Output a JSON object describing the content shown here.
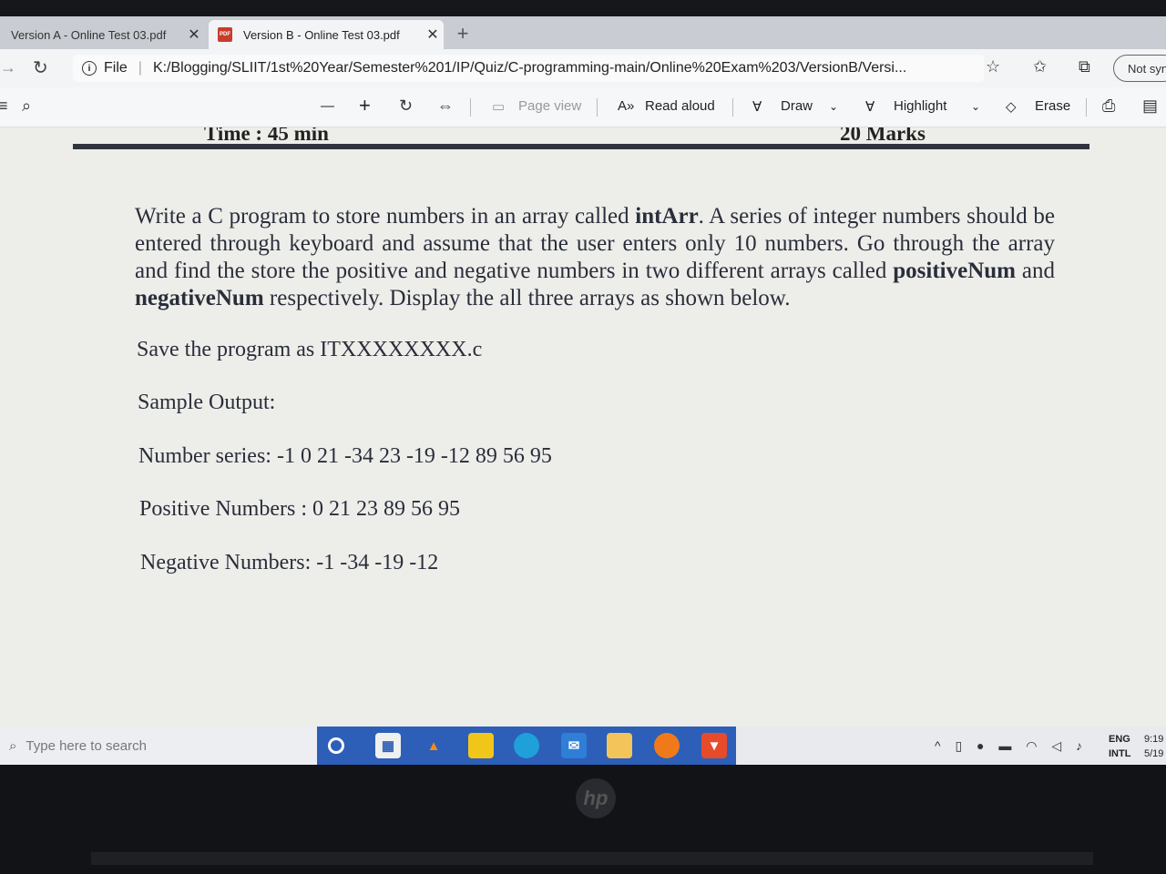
{
  "tabs": [
    {
      "label": "Version A - Online Test 03.pdf",
      "close": "✕"
    },
    {
      "label": "Version B - Online Test 03.pdf",
      "close": "✕"
    }
  ],
  "new_tab": "+",
  "address": {
    "info": "i",
    "file_label": "File",
    "separator": "|",
    "url": "K:/Blogging/SLIIT/1st%20Year/Semester%201/IP/Quiz/C-programming-main/Online%20Exam%203/VersionB/Versi...",
    "profile": "Not syn"
  },
  "toolbar": {
    "minus": "—",
    "plus": "+",
    "page_view": "Page view",
    "read_aloud": "Read aloud",
    "draw": "Draw",
    "highlight": "Highlight",
    "erase": "Erase"
  },
  "document": {
    "header_time": "Time : 45 min",
    "header_marks": "20 Marks",
    "paragraph": [
      {
        "text": "Write a C program to store numbers in an array called "
      },
      {
        "text": "intArr",
        "bold": true
      },
      {
        "text": ". A series of integer numbers should be entered through keyboard and assume that the user enters only 10 numbers. Go through the array and find the store the positive and negative numbers in two different arrays called "
      },
      {
        "text": "positiveNum",
        "bold": true
      },
      {
        "text": " and "
      },
      {
        "text": "negativeNum",
        "bold": true
      },
      {
        "text": " respectively. Display the all three arrays as shown below."
      }
    ],
    "save_line": "Save the program as ITXXXXXXXX.c",
    "sample_heading": "Sample Output:",
    "number_series": "Number series: -1 0 21 -34 23 -19 -12 89 56 95",
    "positive_numbers": "Positive Numbers :  0 21 23 89 56 95",
    "negative_numbers": "Negative Numbers: -1 -34 -19 -12"
  },
  "taskbar": {
    "search_placeholder": "Type here to search",
    "lang_top": "ENG",
    "lang_bottom": "INTL",
    "time": "9:19",
    "date": "5/19"
  },
  "colors": {
    "taskbar_apps_bg": "#2d5fb8",
    "page_bg": "#ededea",
    "header_rule": "#2f3440"
  }
}
